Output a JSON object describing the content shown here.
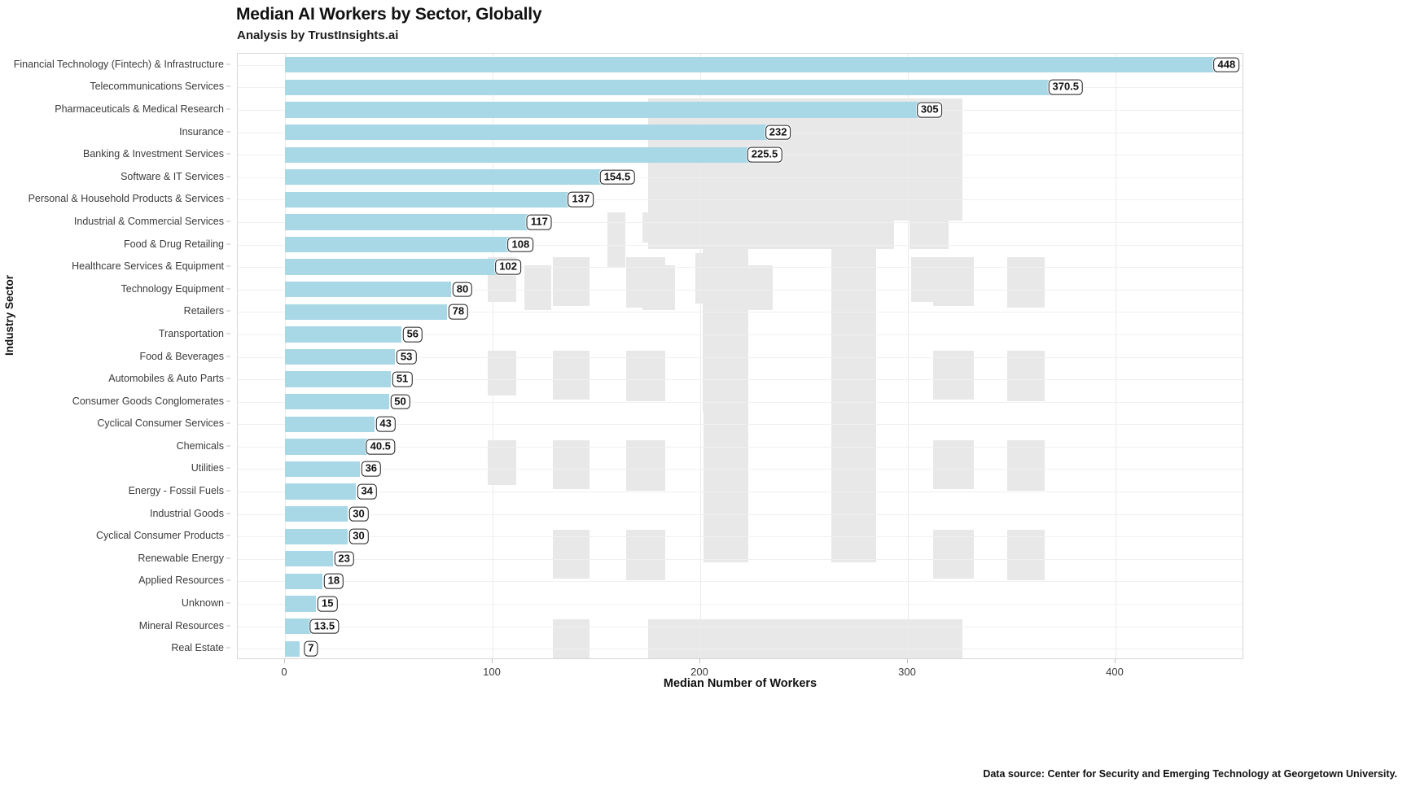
{
  "header": {
    "title": "Median AI Workers by Sector, Globally",
    "subtitle": "Analysis by TrustInsights.ai"
  },
  "footer": {
    "source": "Data source: Center for Security and Emerging Technology at Georgetown University."
  },
  "axes": {
    "y_title": "Industry Sector",
    "x_title": "Median Number of Workers",
    "x_ticks": [
      "0",
      "100",
      "200",
      "300",
      "400"
    ]
  },
  "style": {
    "bar_color": "#a8d8e6",
    "watermark_color": "#e8e8e8",
    "grid_color": "#ebebeb",
    "label_border_color": "#1c1c1c"
  },
  "chart_data": {
    "type": "bar",
    "orientation": "horizontal",
    "title": "Median AI Workers by Sector, Globally",
    "subtitle": "Analysis by TrustInsights.ai",
    "xlabel": "Median Number of Workers",
    "ylabel": "Industry Sector",
    "xlim": [
      0,
      460
    ],
    "xticks": [
      0,
      100,
      200,
      300,
      400
    ],
    "grid": true,
    "legend": "none",
    "source": "Data source: Center for Security and Emerging Technology at Georgetown University.",
    "categories": [
      "Financial Technology (Fintech) & Infrastructure",
      "Telecommunications Services",
      "Pharmaceuticals & Medical Research",
      "Insurance",
      "Banking & Investment Services",
      "Software & IT Services",
      "Personal & Household Products & Services",
      "Industrial & Commercial Services",
      "Food & Drug Retailing",
      "Healthcare Services & Equipment",
      "Technology Equipment",
      "Retailers",
      "Transportation",
      "Food & Beverages",
      "Automobiles & Auto Parts",
      "Consumer Goods Conglomerates",
      "Cyclical Consumer Services",
      "Chemicals",
      "Utilities",
      "Energy - Fossil Fuels",
      "Industrial Goods",
      "Cyclical Consumer Products",
      "Renewable Energy",
      "Applied Resources",
      "Unknown",
      "Mineral Resources",
      "Real Estate"
    ],
    "values": [
      448,
      370.5,
      305,
      232,
      225.5,
      154.5,
      137,
      117,
      108,
      102,
      80,
      78,
      56,
      53,
      51,
      50,
      43,
      40.5,
      36,
      34,
      30,
      30,
      23,
      18,
      15,
      13.5,
      7
    ],
    "value_labels": [
      "448",
      "370.5",
      "305",
      "232",
      "225.5",
      "154.5",
      "137",
      "117",
      "108",
      "102",
      "80",
      "78",
      "56",
      "53",
      "51",
      "50",
      "43",
      "40.5",
      "36",
      "34",
      "30",
      "30",
      "23",
      "18",
      "15",
      "13.5",
      "7"
    ]
  }
}
